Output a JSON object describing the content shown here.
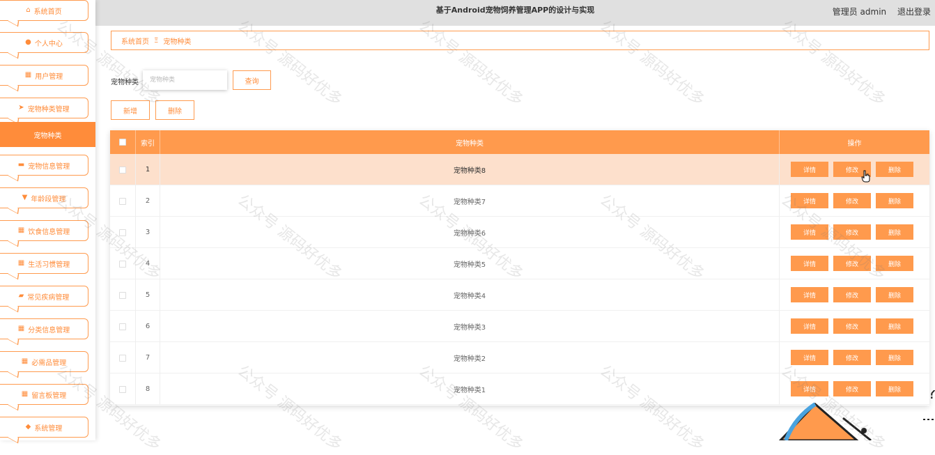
{
  "header": {
    "title": "基于Android宠物饲养管理APP的设计与实现",
    "user_label": "管理员 admin",
    "logout": "退出登录"
  },
  "sidebar": {
    "items": [
      {
        "label": "系统首页",
        "icon": "home-icon"
      },
      {
        "label": "个人中心",
        "icon": "user-icon"
      },
      {
        "label": "用户管理",
        "icon": "grid-icon"
      },
      {
        "label": "宠物种类管理",
        "icon": "send-icon"
      },
      {
        "label": "宠物信息管理",
        "icon": "monitor-icon"
      },
      {
        "label": "年龄段管理",
        "icon": "cup-icon"
      },
      {
        "label": "饮食信息管理",
        "icon": "grid-icon"
      },
      {
        "label": "生活习惯管理",
        "icon": "grid-icon"
      },
      {
        "label": "常见疾病管理",
        "icon": "briefcase-icon"
      },
      {
        "label": "分类信息管理",
        "icon": "grid-icon"
      },
      {
        "label": "必需品管理",
        "icon": "grid-icon"
      },
      {
        "label": "留言板管理",
        "icon": "grid-icon"
      },
      {
        "label": "系统管理",
        "icon": "pin-icon"
      }
    ],
    "active_sub": "宠物种类"
  },
  "breadcrumb": {
    "home": "系统首页",
    "sep": "Ξ",
    "current": "宠物种类"
  },
  "search": {
    "label": "宠物种类",
    "placeholder": "宠物种类",
    "button": "查询"
  },
  "toolbar": {
    "add": "新增",
    "delete": "删除"
  },
  "table": {
    "headers": [
      "",
      "索引",
      "宠物种类",
      "操作"
    ],
    "rows": [
      {
        "index": "1",
        "name": "宠物种类8"
      },
      {
        "index": "2",
        "name": "宠物种类7"
      },
      {
        "index": "3",
        "name": "宠物种类6"
      },
      {
        "index": "4",
        "name": "宠物种类5"
      },
      {
        "index": "5",
        "name": "宠物种类4"
      },
      {
        "index": "6",
        "name": "宠物种类3"
      },
      {
        "index": "7",
        "name": "宠物种类2"
      },
      {
        "index": "8",
        "name": "宠物种类1"
      }
    ],
    "actions": [
      "详情",
      "修改",
      "删除"
    ]
  },
  "watermark": "公众号 源码好优多",
  "colors": {
    "accent": "#ff9a4d",
    "active_row": "#fde0cc",
    "topbar": "#e0e0e0"
  }
}
